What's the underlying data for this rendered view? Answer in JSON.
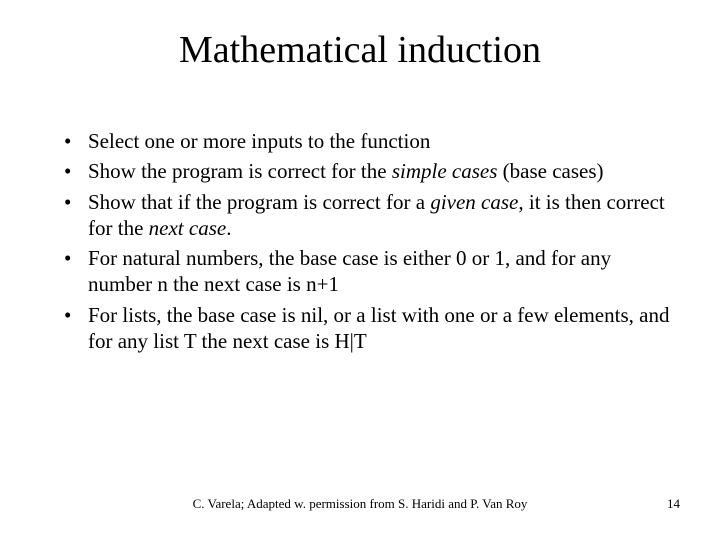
{
  "title": "Mathematical induction",
  "bullets": {
    "b1": "Select one or more inputs to the function",
    "b2_a": "Show the program is correct for the ",
    "b2_i": "simple cases",
    "b2_b": " (base cases)",
    "b3_a": "Show that if the program is correct for a ",
    "b3_i1": "given case",
    "b3_b": ", it is then correct for the ",
    "b3_i2": "next case",
    "b3_c": ".",
    "b4": "For natural numbers, the base case is either 0 or 1, and for any number n the next case is n+1",
    "b5": "For lists, the base case is nil, or a list with one or a few elements, and for any list T the next case is H|T"
  },
  "footer": {
    "attribution": "C. Varela;  Adapted w. permission from S. Haridi and P. Van Roy",
    "page": "14"
  }
}
